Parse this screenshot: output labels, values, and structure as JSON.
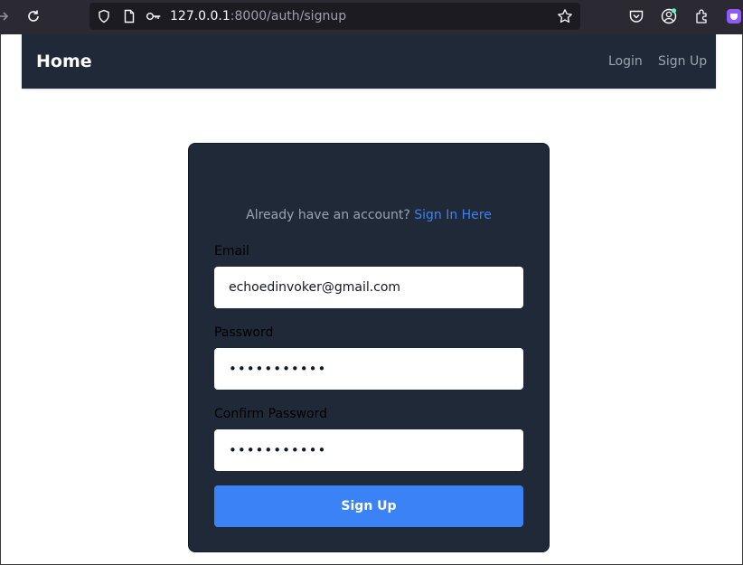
{
  "browser": {
    "url_host": "127.0.0.1",
    "url_rest": ":8000/auth/signup"
  },
  "navbar": {
    "brand": "Home",
    "links": [
      "Login",
      "Sign Up"
    ]
  },
  "signup": {
    "hint_text": "Already have an account?",
    "hint_link": "Sign In Here",
    "email_label": "Email",
    "email_value": "echoedinvoker@gmail.com",
    "password_label": "Password",
    "password_value": "•••••••••••",
    "confirm_label": "Confirm Password",
    "confirm_value": "•••••••••••",
    "submit_label": "Sign Up"
  },
  "colors": {
    "navbar_bg": "#1f2937",
    "card_bg": "#1f2937",
    "accent": "#3b82f6"
  }
}
